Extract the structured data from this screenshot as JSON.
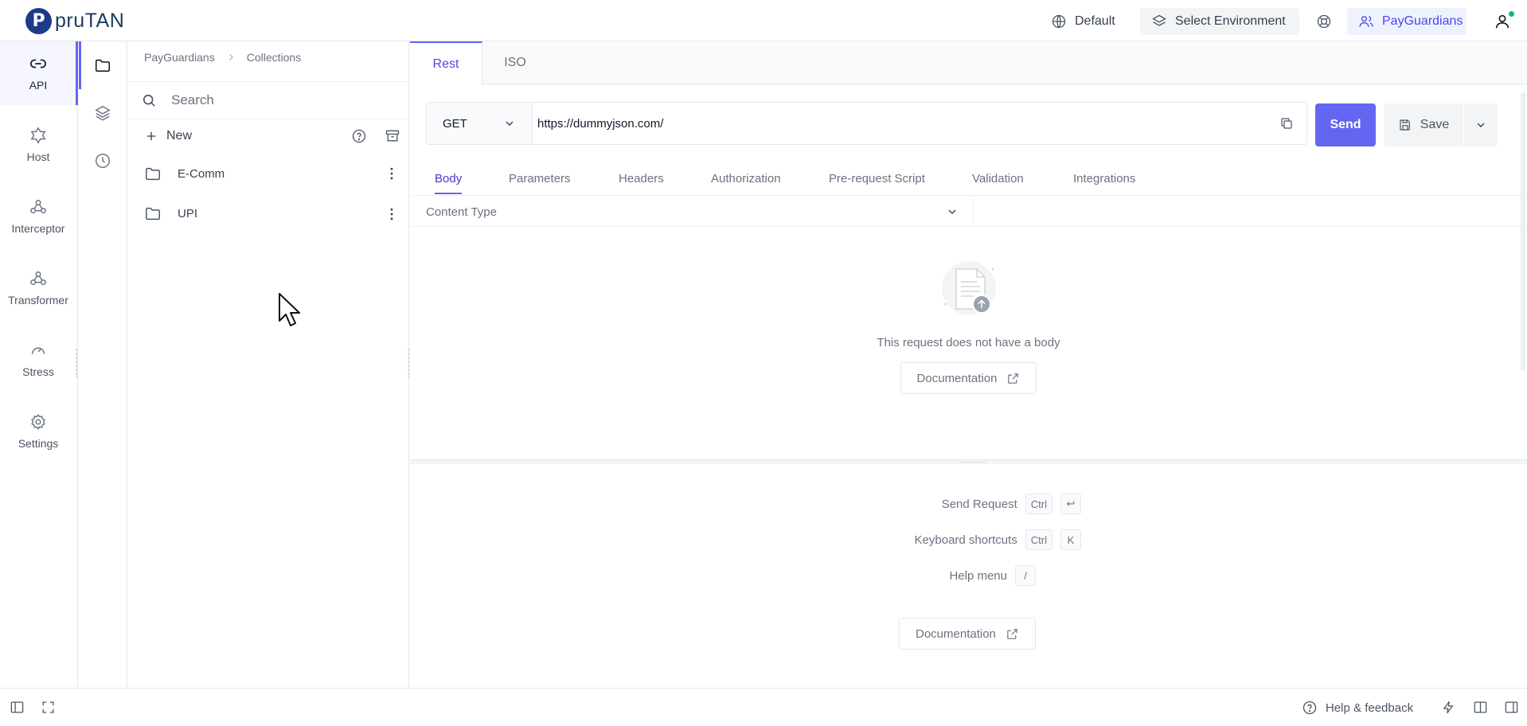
{
  "app": {
    "logo_letter": "P",
    "logo_text": "pruTAN"
  },
  "topbar": {
    "language_label": "Default",
    "environment_label": "Select Environment",
    "workspace_label": "PayGuardians",
    "icons": [
      "globe-icon",
      "layers-icon",
      "support-icon",
      "users-icon",
      "user-icon"
    ],
    "status_dot_color": "#10b981"
  },
  "rail": {
    "items": [
      {
        "label": "API",
        "icon": "link-icon",
        "active": true
      },
      {
        "label": "Host",
        "icon": "hexagon-icon",
        "active": false
      },
      {
        "label": "Interceptor",
        "icon": "webhook-icon",
        "active": false
      },
      {
        "label": "Transformer",
        "icon": "webhook-icon",
        "active": false
      },
      {
        "label": "Stress",
        "icon": "gauge-icon",
        "active": false
      },
      {
        "label": "Settings",
        "icon": "gear-icon",
        "active": false
      }
    ]
  },
  "rail2": {
    "items": [
      {
        "icon": "folder-icon",
        "active": true
      },
      {
        "icon": "layers-icon",
        "active": false
      },
      {
        "icon": "history-icon",
        "active": false
      }
    ]
  },
  "collections": {
    "breadcrumb": [
      "PayGuardians",
      "Collections"
    ],
    "search_placeholder": "Search",
    "new_label": "New",
    "items": [
      {
        "name": "E-Comm"
      },
      {
        "name": "UPI"
      }
    ]
  },
  "main": {
    "protocol_tabs": [
      {
        "label": "Rest",
        "active": true
      },
      {
        "label": "ISO",
        "active": false
      }
    ],
    "method": "GET",
    "url": "https://dummyjson.com/",
    "send_label": "Send",
    "save_label": "Save",
    "request_tabs": [
      {
        "label": "Body",
        "active": true
      },
      {
        "label": "Parameters",
        "active": false
      },
      {
        "label": "Headers",
        "active": false
      },
      {
        "label": "Authorization",
        "active": false
      },
      {
        "label": "Pre-request Script",
        "active": false
      },
      {
        "label": "Validation",
        "active": false
      },
      {
        "label": "Integrations",
        "active": false
      }
    ],
    "content_type_label": "Content Type",
    "empty_body_text": "This request does not have a body",
    "documentation_label": "Documentation"
  },
  "response": {
    "shortcuts": [
      {
        "label": "Send Request",
        "keys": [
          "Ctrl",
          "↩"
        ]
      },
      {
        "label": "Keyboard shortcuts",
        "keys": [
          "Ctrl",
          "K"
        ]
      },
      {
        "label": "Help menu",
        "keys": [
          "/"
        ]
      }
    ],
    "documentation_label": "Documentation"
  },
  "footer": {
    "help_label": "Help & feedback"
  },
  "colors": {
    "accent": "#6366f1",
    "brand": "#1e3a8a"
  }
}
